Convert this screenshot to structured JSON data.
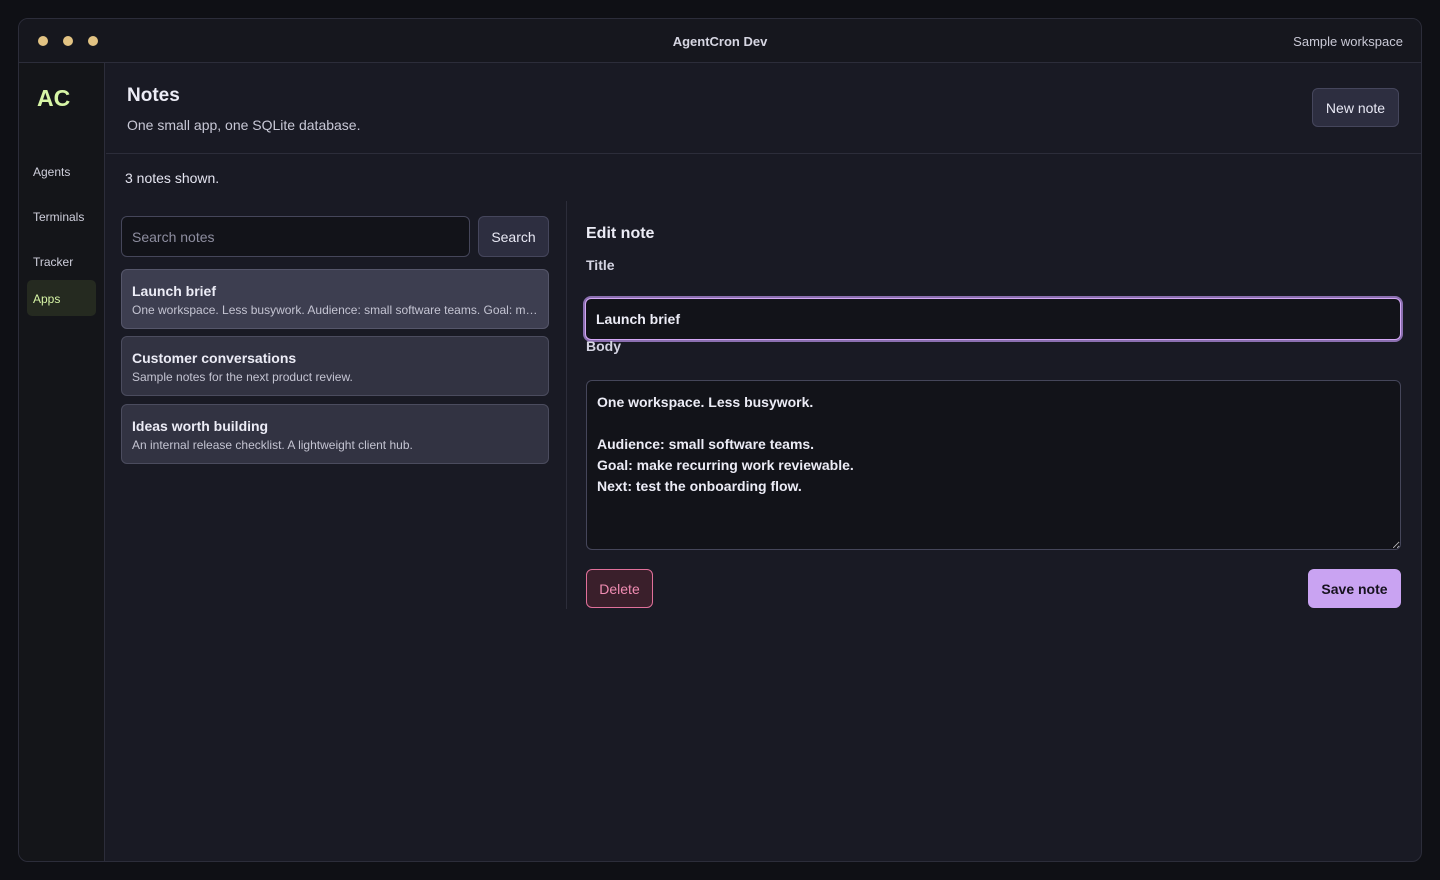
{
  "window": {
    "title": "AgentCron Dev",
    "workspace": "Sample workspace"
  },
  "sidebar": {
    "logo": "AC",
    "items": [
      {
        "label": "Agents"
      },
      {
        "label": "Terminals"
      },
      {
        "label": "Tracker"
      },
      {
        "label": "Apps",
        "active": true
      }
    ]
  },
  "header": {
    "title": "Notes",
    "subtitle": "One small app, one SQLite database.",
    "new_note_label": "New note"
  },
  "list": {
    "count_text": "3 notes shown.",
    "search_placeholder": "Search notes",
    "search_value": "",
    "search_label": "Search",
    "notes": [
      {
        "title": "Launch brief",
        "preview": "One workspace. Less busywork. Audience: small software teams. Goal: make recurring work reviewable.",
        "selected": true
      },
      {
        "title": "Customer conversations",
        "preview": "Sample notes for the next product review."
      },
      {
        "title": "Ideas worth building",
        "preview": "An internal release checklist. A lightweight client hub."
      }
    ]
  },
  "editor": {
    "heading": "Edit note",
    "title_label": "Title",
    "title_value": "Launch brief",
    "body_label": "Body",
    "body_value": "One workspace. Less busywork.\n\nAudience: small software teams.\nGoal: make recurring work reviewable.\nNext: test the onboarding flow.",
    "delete_label": "Delete",
    "save_label": "Save note"
  },
  "colors": {
    "accent": "#c9a3f2",
    "brand": "#d7f5a6",
    "danger": "#f08cb2",
    "window_dot": "#e2c383"
  }
}
